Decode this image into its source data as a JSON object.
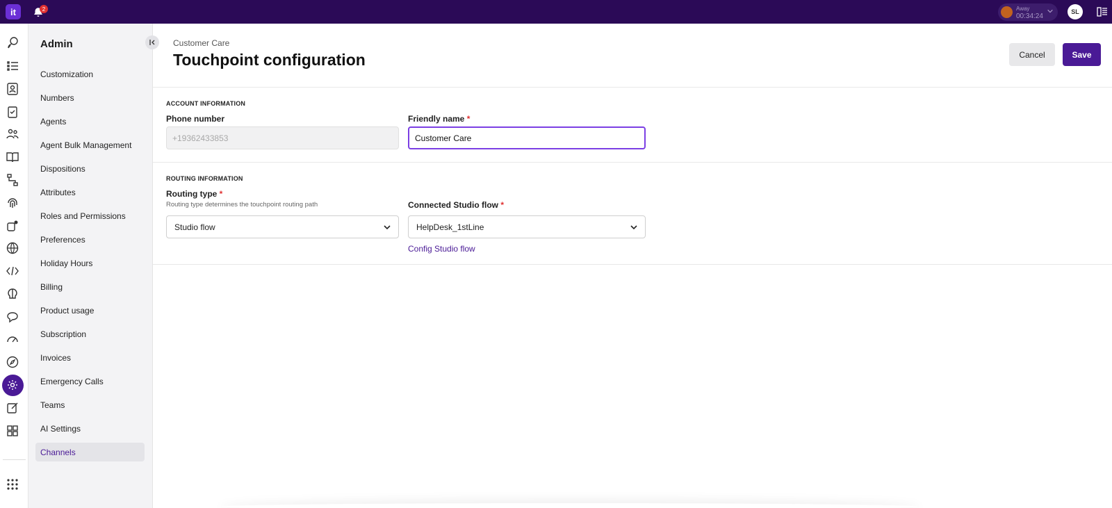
{
  "topbar": {
    "logo_text": "it",
    "notification_count": "2",
    "status_label": "Away",
    "status_timer": "00:34:24",
    "avatar_initials": "SL"
  },
  "rail": {
    "icons": [
      "chat-bubbles-icon",
      "list-tasks-icon",
      "contacts-icon",
      "clipboard-icon",
      "users-icon",
      "book-icon",
      "flow-icon",
      "fingerprint-icon",
      "settings-gear-icon",
      "globe-icon",
      "code-icon",
      "brain-icon",
      "chat-icon",
      "speedometer-icon",
      "compass-icon",
      "admin-gear-icon",
      "edit-icon",
      "grid-icon",
      "apps-icon"
    ],
    "active_index": 15
  },
  "sidebar": {
    "title": "Admin",
    "items": [
      {
        "label": "Customization"
      },
      {
        "label": "Numbers"
      },
      {
        "label": "Agents"
      },
      {
        "label": "Agent Bulk Management"
      },
      {
        "label": "Dispositions"
      },
      {
        "label": "Attributes"
      },
      {
        "label": "Roles and Permissions"
      },
      {
        "label": "Preferences"
      },
      {
        "label": "Holiday Hours"
      },
      {
        "label": "Billing"
      },
      {
        "label": "Product usage"
      },
      {
        "label": "Subscription"
      },
      {
        "label": "Invoices"
      },
      {
        "label": "Emergency Calls"
      },
      {
        "label": "Teams"
      },
      {
        "label": "AI Settings"
      },
      {
        "label": "Channels"
      }
    ],
    "active_item": "Channels"
  },
  "header": {
    "breadcrumb": "Customer Care",
    "title": "Touchpoint configuration",
    "cancel_label": "Cancel",
    "save_label": "Save"
  },
  "account": {
    "section_title": "ACCOUNT INFORMATION",
    "phone_label": "Phone number",
    "phone_value": "+19362433853",
    "friendly_label": "Friendly name",
    "friendly_value": "Customer Care",
    "required_mark": "*"
  },
  "routing": {
    "section_title": "ROUTING INFORMATION",
    "type_label": "Routing type",
    "type_help": "Routing type determines the touchpoint routing path",
    "type_value": "Studio flow",
    "flow_label": "Connected Studio flow",
    "flow_value": "HelpDesk_1stLine",
    "config_link": "Config Studio flow",
    "required_mark": "*"
  },
  "colors": {
    "topbar": "#2b0a57",
    "accent": "#4a1a96",
    "focus": "#7b3fe4",
    "required": "#e03131"
  }
}
